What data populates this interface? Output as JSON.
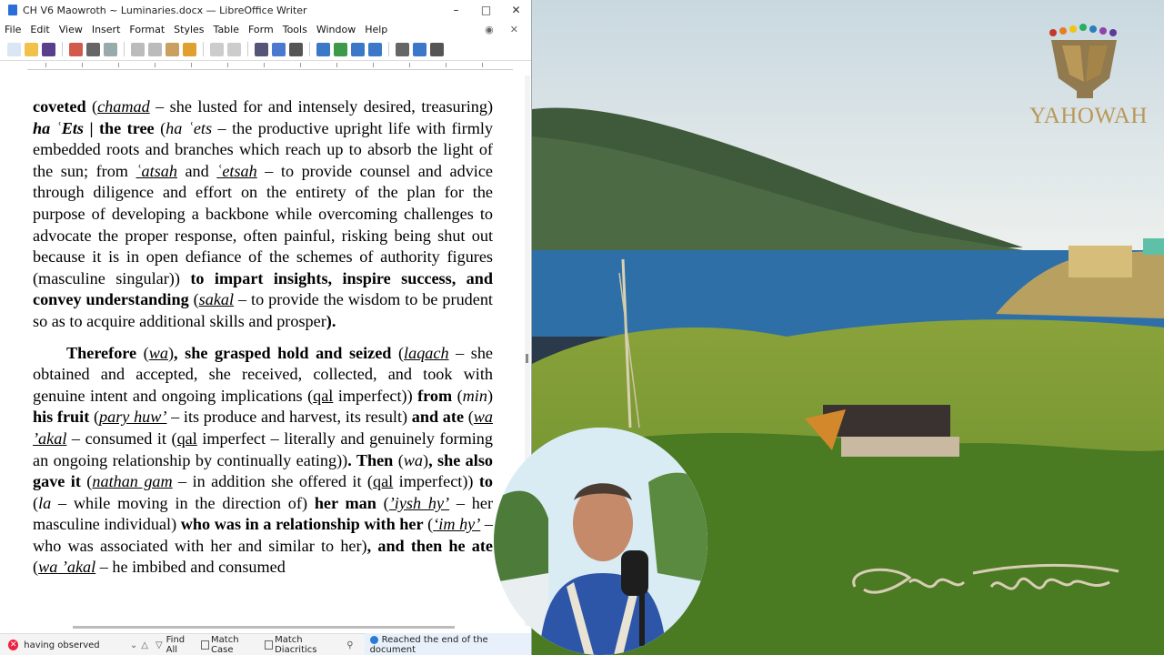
{
  "window": {
    "title": "CH V6 Maowroth ~ Luminaries.docx — LibreOffice Writer",
    "controls": [
      "–",
      "□",
      "✕"
    ]
  },
  "menu": [
    "File",
    "Edit",
    "View",
    "Insert",
    "Format",
    "Styles",
    "Table",
    "Form",
    "Tools",
    "Window",
    "Help"
  ],
  "document": {
    "paragraph1": [
      {
        "t": "coveted",
        "b": true
      },
      {
        "t": " ("
      },
      {
        "t": "chamad",
        "i": true,
        "u": true
      },
      {
        "t": " – she lusted for and intensely desired, treasuring) "
      },
      {
        "t": "ha ʿEts",
        "b": true,
        "i": true
      },
      {
        "t": " | the tree",
        "b": true
      },
      {
        "t": " ("
      },
      {
        "t": "ha ʿets",
        "i": true
      },
      {
        "t": " – the productive upright life with firmly embedded roots and branches which reach up to absorb the light of the sun; from "
      },
      {
        "t": "ʿatsah",
        "i": true,
        "u": true
      },
      {
        "t": " and "
      },
      {
        "t": "ʿetsah",
        "i": true,
        "u": true
      },
      {
        "t": " – to provide counsel and advice through diligence and effort on the entirety of the plan for the purpose of developing a backbone while overcoming challenges to advocate the proper response, often painful, risking being shut out because it is in open defiance of the schemes of authority figures (masculine singular)) "
      },
      {
        "t": "to impart insights, inspire success, and convey understanding",
        "b": true
      },
      {
        "t": " ("
      },
      {
        "t": "sakal",
        "i": true,
        "u": true
      },
      {
        "t": " – to provide the wisdom to be prudent so as to acquire additional skills and prosper"
      },
      {
        "t": ").",
        "b": true
      }
    ],
    "paragraph2": [
      {
        "t": "Therefore",
        "b": true
      },
      {
        "t": " ("
      },
      {
        "t": "wa",
        "i": true,
        "u": true
      },
      {
        "t": ")"
      },
      {
        "t": ", she grasped hold and seized",
        "b": true
      },
      {
        "t": " ("
      },
      {
        "t": "laqach",
        "i": true,
        "u": true
      },
      {
        "t": " – she obtained and accepted, she received, collected, and took with genuine intent and ongoing implications ("
      },
      {
        "t": "qal",
        "u": true
      },
      {
        "t": " imperfect)) "
      },
      {
        "t": "from",
        "b": true
      },
      {
        "t": " ("
      },
      {
        "t": "min",
        "i": true
      },
      {
        "t": ") "
      },
      {
        "t": "his fruit",
        "b": true
      },
      {
        "t": " ("
      },
      {
        "t": "pary huw’",
        "i": true,
        "u": true
      },
      {
        "t": " – its produce and harvest, its result) "
      },
      {
        "t": "and ate",
        "b": true
      },
      {
        "t": " ("
      },
      {
        "t": "wa ’akal",
        "i": true,
        "u": true
      },
      {
        "t": " – consumed it ("
      },
      {
        "t": "qal",
        "u": true
      },
      {
        "t": " imperfect – literally and genuinely forming an ongoing relationship by continually eating))"
      },
      {
        "t": ". Then",
        "b": true
      },
      {
        "t": " ("
      },
      {
        "t": "wa",
        "i": true
      },
      {
        "t": ")"
      },
      {
        "t": ", she also gave it",
        "b": true
      },
      {
        "t": " ("
      },
      {
        "t": "nathan gam",
        "i": true,
        "u": true
      },
      {
        "t": " – in addition she offered it ("
      },
      {
        "t": "qal",
        "u": true
      },
      {
        "t": " imperfect)) "
      },
      {
        "t": "to",
        "b": true
      },
      {
        "t": " ("
      },
      {
        "t": "la",
        "i": true
      },
      {
        "t": " – while moving in the direction of) "
      },
      {
        "t": "her man",
        "b": true
      },
      {
        "t": " ("
      },
      {
        "t": "’iysh hy’",
        "i": true,
        "u": true
      },
      {
        "t": " – her masculine individual) "
      },
      {
        "t": "who was in a relationship with her",
        "b": true
      },
      {
        "t": " ("
      },
      {
        "t": "‘im hy’",
        "i": true,
        "u": true
      },
      {
        "t": " – who was associated with her and similar to her)"
      },
      {
        "t": ", and then he ate",
        "b": true
      },
      {
        "t": " ("
      },
      {
        "t": "wa ’akal",
        "i": true,
        "u": true
      },
      {
        "t": " – he imbibed and consumed"
      }
    ]
  },
  "findbar": {
    "search_value": "having observed",
    "find_all": "Find All",
    "match_case": "Match Case",
    "match_diacritics": "Match Diacritics",
    "status": "Reached the end of the document"
  },
  "logo": {
    "text": "YAHOWAH"
  },
  "signature": {
    "text": "Craig Winn"
  },
  "colors": {
    "logo_gold": "#b99858",
    "find_status_bg": "#e8f0fb",
    "sea": "#2f6fa8"
  }
}
